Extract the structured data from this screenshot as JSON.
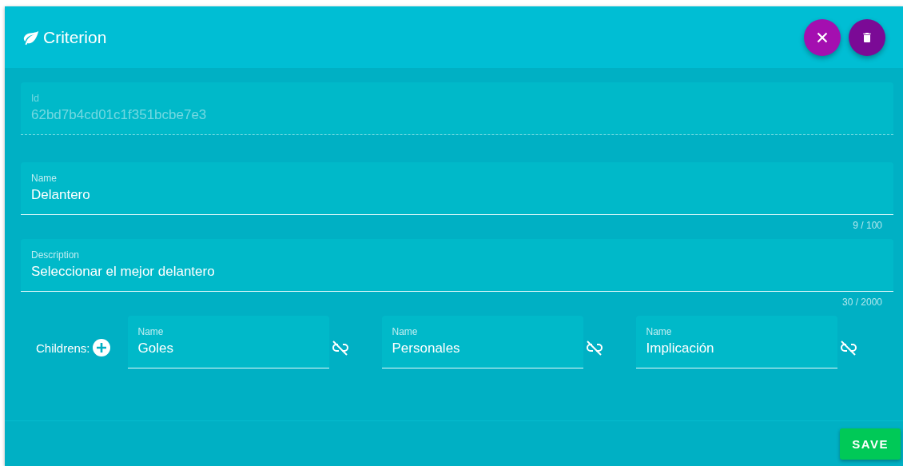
{
  "header": {
    "title": "Criterion"
  },
  "fields": [
    {
      "label": "Id",
      "value": "62bd7b4cd01c1f351bcbe7e3",
      "disabled": true
    },
    {
      "label": "Name",
      "value": "Delantero",
      "disabled": false,
      "counter": "9 / 100"
    },
    {
      "label": "Description",
      "value": "Seleccionar el mejor delantero",
      "disabled": false,
      "counter": "30 / 2000"
    }
  ],
  "children": {
    "label": "Childrens:",
    "items": [
      {
        "label": "Name",
        "value": "Goles"
      },
      {
        "label": "Name",
        "value": "Personales"
      },
      {
        "label": "Name",
        "value": "Implicación"
      }
    ]
  },
  "save_button": "SAVE"
}
